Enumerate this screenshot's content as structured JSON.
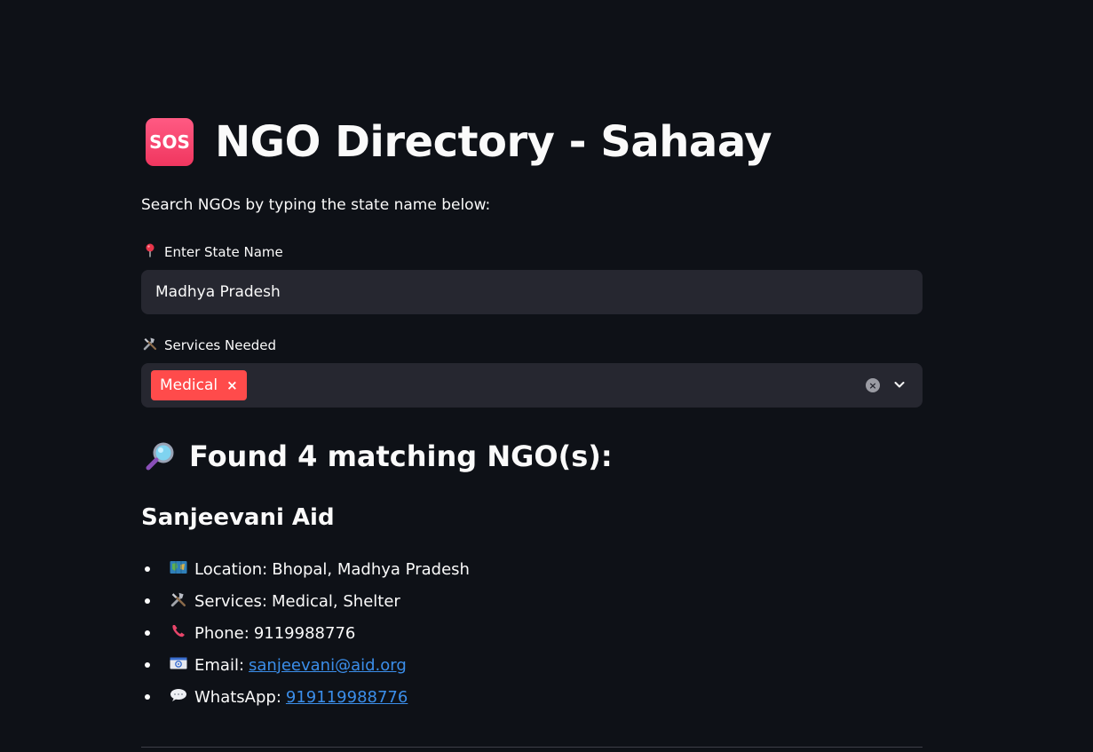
{
  "header": {
    "icon_text": "SOS",
    "title": "NGO Directory - Sahaay"
  },
  "subtitle": "Search NGOs by typing the state name below:",
  "state_input": {
    "icon": "pin-icon",
    "label": "Enter State Name",
    "value": "Madhya Pradesh"
  },
  "services_select": {
    "icon": "tools-icon",
    "label": "Services Needed",
    "selected": [
      "Medical"
    ],
    "remove_symbol": "×"
  },
  "results": {
    "icon": "magnifier-icon",
    "heading": "Found 4 matching NGO(s):"
  },
  "ngo": {
    "name": "Sanjeevani Aid",
    "location_label": "Location:",
    "location": "Bhopal, Madhya Pradesh",
    "services_label": "Services:",
    "services": "Medical, Shelter",
    "phone_label": "Phone:",
    "phone": "9119988776",
    "email_label": "Email:",
    "email": "sanjeevani@aid.org",
    "whatsapp_label": "WhatsApp:",
    "whatsapp": "919119988776"
  },
  "colors": {
    "background": "#0e1117",
    "input_bg": "#262730",
    "tag_bg": "#ff4b4b",
    "link": "#3b8eea"
  }
}
